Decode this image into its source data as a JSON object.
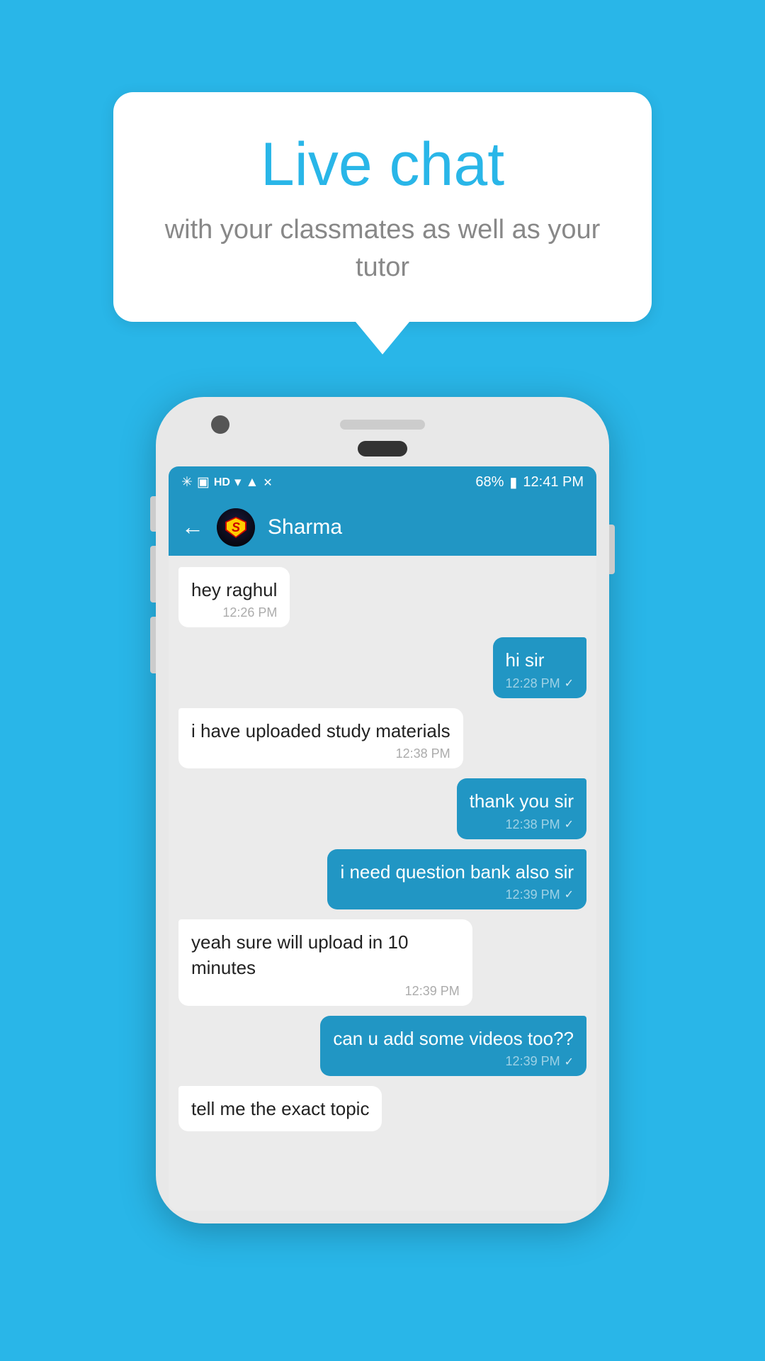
{
  "background_color": "#29b6e8",
  "bubble": {
    "title": "Live chat",
    "subtitle": "with your classmates as well as your tutor"
  },
  "status_bar": {
    "time": "12:41 PM",
    "battery": "68%",
    "icons": "🔵📶📶"
  },
  "chat_header": {
    "back_label": "←",
    "contact_name": "Sharma"
  },
  "messages": [
    {
      "type": "received",
      "text": "hey raghul",
      "time": "12:26 PM",
      "tick": ""
    },
    {
      "type": "sent",
      "text": "hi sir",
      "time": "12:28 PM",
      "tick": "✓"
    },
    {
      "type": "received",
      "text": "i have uploaded study materials",
      "time": "12:38 PM",
      "tick": ""
    },
    {
      "type": "sent",
      "text": "thank you sir",
      "time": "12:38 PM",
      "tick": "✓"
    },
    {
      "type": "sent",
      "text": "i need question bank also sir",
      "time": "12:39 PM",
      "tick": "✓"
    },
    {
      "type": "received",
      "text": "yeah sure will upload in 10 minutes",
      "time": "12:39 PM",
      "tick": ""
    },
    {
      "type": "sent",
      "text": "can u add some videos too??",
      "time": "12:39 PM",
      "tick": "✓"
    },
    {
      "type": "received",
      "text": "tell me the exact topic",
      "time": "",
      "tick": ""
    }
  ]
}
